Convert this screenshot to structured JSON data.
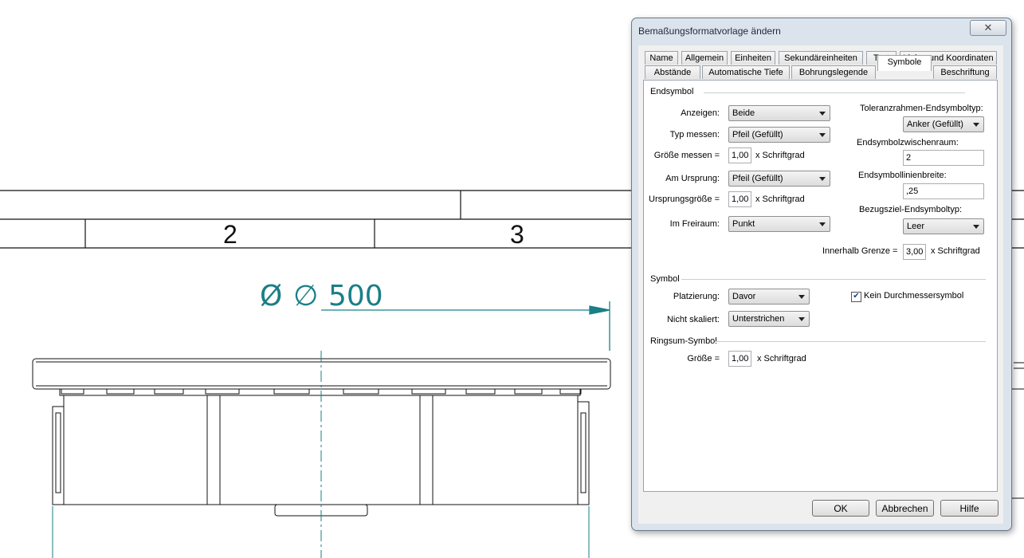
{
  "drawing": {
    "title_block_numbers": [
      "2",
      "3"
    ],
    "dimension": {
      "prefix_symbol": "Ø",
      "diameter_symbol": "∅",
      "value": "500"
    }
  },
  "dialog": {
    "title": "Bemaßungsformatvorlage ändern",
    "close_glyph": "✕",
    "tabs_row1": [
      "Name",
      "Allgemein",
      "Einheiten",
      "Sekundäreinheiten",
      "Text",
      "Linien und Koordinaten"
    ],
    "tabs_row2": [
      "Abstände",
      "Automatische Tiefe",
      "Bohrungslegende",
      "Symbole",
      "Beschriftung"
    ],
    "active_tab": "Symbole",
    "endsymbol": {
      "section_label": "Endsymbol",
      "anzeigen_label": "Anzeigen:",
      "anzeigen_value": "Beide",
      "typ_messen_label": "Typ messen:",
      "typ_messen_value": "Pfeil (Gefüllt)",
      "groesse_messen_label": "Größe messen =",
      "groesse_messen_value": "1,00",
      "groesse_messen_unit": "x Schriftgrad",
      "am_ursprung_label": "Am Ursprung:",
      "am_ursprung_value": "Pfeil (Gefüllt)",
      "ursprungsgroesse_label": "Ursprungsgröße =",
      "ursprungsgroesse_value": "1,00",
      "ursprungsgroesse_unit": "x Schriftgrad",
      "im_freiraum_label": "Im Freiraum:",
      "im_freiraum_value": "Punkt",
      "toleranz_label": "Toleranzrahmen-Endsymboltyp:",
      "toleranz_value": "Anker (Gefüllt)",
      "zwischenraum_label": "Endsymbolzwischenraum:",
      "zwischenraum_value": "2",
      "linienbreite_label": "Endsymbollinienbreite:",
      "linienbreite_value": ",25",
      "bezugsziel_label": "Bezugsziel-Endsymboltyp:",
      "bezugsziel_value": "Leer",
      "innerhalb_label": "Innerhalb Grenze =",
      "innerhalb_value": "3,00",
      "innerhalb_unit": "x Schriftgrad"
    },
    "symbol": {
      "section_label": "Symbol",
      "platzierung_label": "Platzierung:",
      "platzierung_value": "Davor",
      "nicht_skaliert_label": "Nicht skaliert:",
      "nicht_skaliert_value": "Unterstrichen",
      "kein_durchmesser_label": "Kein Durchmessersymbol",
      "kein_durchmesser_checked": true
    },
    "ringsum": {
      "section_label": "Ringsum-Symbol",
      "groesse_label": "Größe =",
      "groesse_value": "1,00",
      "groesse_unit": "x Schriftgrad"
    },
    "buttons": {
      "ok": "OK",
      "abbrechen": "Abbrechen",
      "hilfe": "Hilfe"
    }
  }
}
